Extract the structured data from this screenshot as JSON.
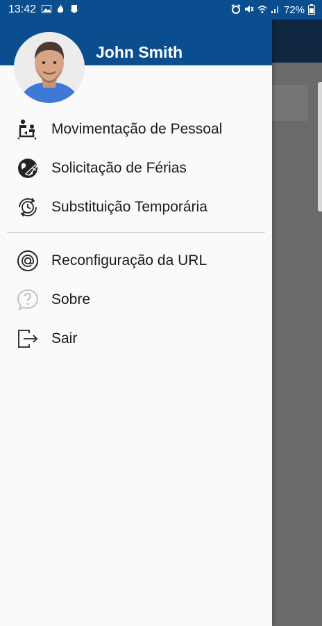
{
  "status_bar": {
    "time": "13:42",
    "battery": "72%",
    "left_icons": [
      "image-icon",
      "flame-icon",
      "download-icon"
    ],
    "right_icons": [
      "alarm-icon",
      "mute-icon",
      "wifi-icon",
      "signal-icon",
      "battery-icon"
    ]
  },
  "drawer": {
    "user_name": "John Smith",
    "menu_primary": [
      {
        "label": "Movimentação de Pessoal",
        "icon": "people-transfer-icon"
      },
      {
        "label": "Solicitação de Férias",
        "icon": "globe-plane-icon"
      },
      {
        "label": "Substituição Temporária",
        "icon": "clock-refresh-icon"
      }
    ],
    "menu_secondary": [
      {
        "label": "Reconfiguração da URL",
        "icon": "at-sign-icon"
      },
      {
        "label": "Sobre",
        "icon": "help-bubble-icon"
      },
      {
        "label": "Sair",
        "icon": "logout-icon"
      }
    ]
  },
  "colors": {
    "header_blue": "#0b4e8f",
    "app_bar": "#0f2740",
    "drawer_bg": "#fafafa",
    "text": "#1b1b1b"
  }
}
